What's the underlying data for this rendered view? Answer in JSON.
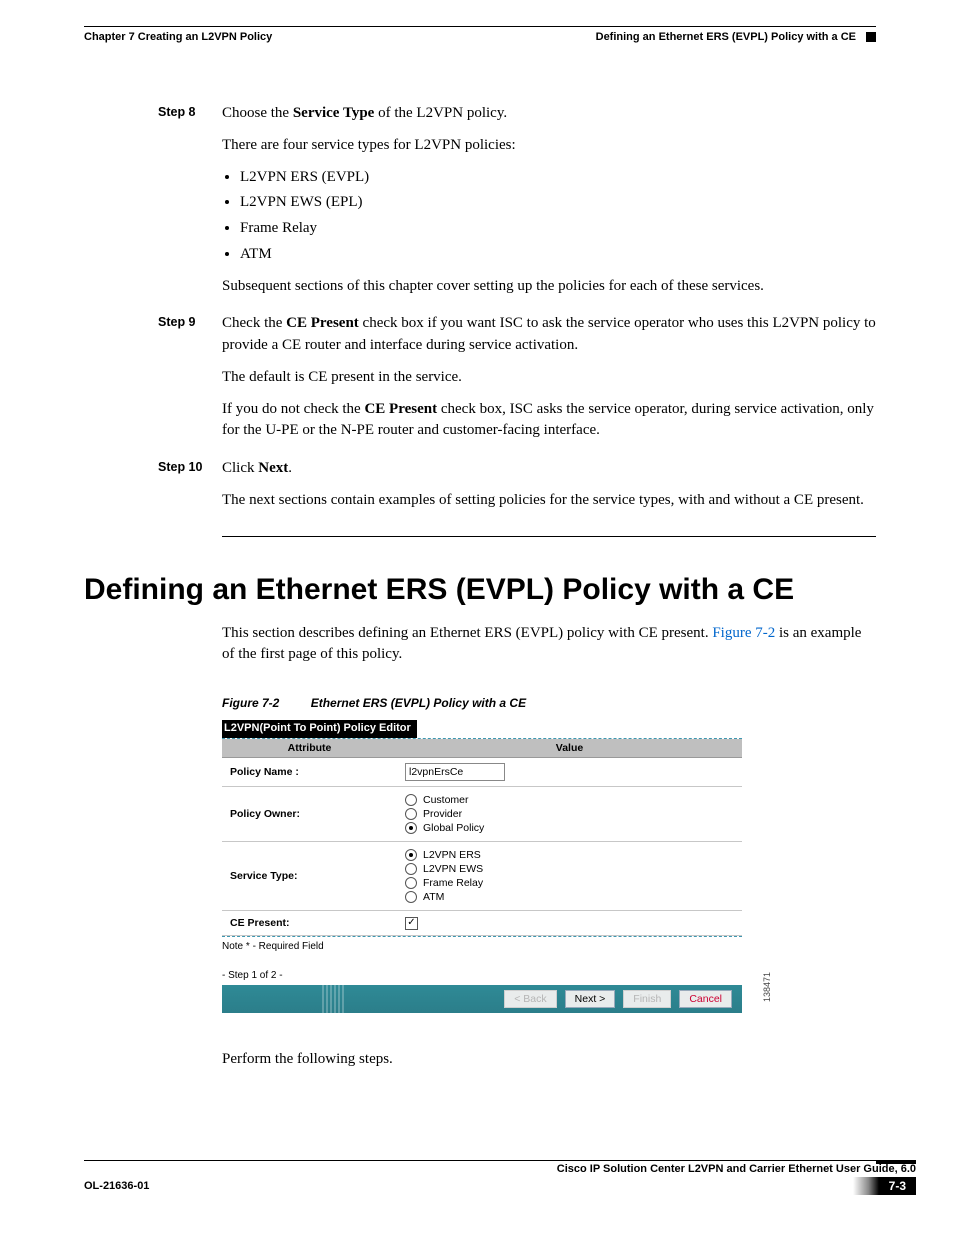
{
  "header": {
    "left": "Chapter 7      Creating an L2VPN Policy",
    "right": "Defining an Ethernet ERS (EVPL) Policy with a CE"
  },
  "steps": [
    {
      "label": "Step 8",
      "p1_pre": "Choose the ",
      "p1_bold": "Service Type",
      "p1_post": " of the L2VPN policy.",
      "p2": "There are four service types for L2VPN policies:",
      "bullets": [
        "L2VPN ERS (EVPL)",
        "L2VPN EWS (EPL)",
        "Frame Relay",
        "ATM"
      ],
      "p3": "Subsequent sections of this chapter cover setting up the policies for each of these services."
    },
    {
      "label": "Step 9",
      "p1_pre": "Check the ",
      "p1_bold": "CE Present",
      "p1_post": " check box if you want ISC to ask the service operator who uses this L2VPN policy to provide a CE router and interface during service activation.",
      "p2": "The default is CE present in the service.",
      "p3_pre": "If you do not check the ",
      "p3_bold": "CE Present",
      "p3_post": " check box, ISC asks the service operator, during service activation, only for the U-PE or the N-PE router and customer-facing interface."
    },
    {
      "label": "Step 10",
      "p1_pre": "Click ",
      "p1_bold": "Next",
      "p1_post": ".",
      "p2": "The next sections contain examples of setting policies for the service types, with and without a CE present."
    }
  ],
  "section": {
    "title": "Defining an Ethernet ERS (EVPL) Policy with a CE",
    "intro_pre": "This section describes defining an Ethernet ERS (EVPL) policy with CE present. ",
    "intro_link": "Figure 7-2",
    "intro_post": " is an example of the first page of this policy."
  },
  "figure": {
    "num": "Figure 7-2",
    "title": "Ethernet ERS (EVPL) Policy with a CE",
    "side_id": "138471"
  },
  "editor": {
    "title": "L2VPN(Point To Point) Policy Editor",
    "col_attr": "Attribute",
    "col_val": "Value",
    "rows": {
      "policy_name_label": "Policy Name :",
      "policy_name_value": "l2vpnErsCe",
      "policy_owner_label": "Policy Owner:",
      "owner_options": [
        {
          "label": "Customer",
          "selected": false
        },
        {
          "label": "Provider",
          "selected": false
        },
        {
          "label": "Global Policy",
          "selected": true
        }
      ],
      "service_type_label": "Service Type:",
      "service_options": [
        {
          "label": "L2VPN ERS",
          "selected": true
        },
        {
          "label": "L2VPN EWS",
          "selected": false
        },
        {
          "label": "Frame Relay",
          "selected": false
        },
        {
          "label": "ATM",
          "selected": false
        }
      ],
      "ce_present_label": "CE Present:",
      "ce_present_checked": true
    },
    "note": "Note * - Required Field",
    "step": "- Step 1 of 2 -",
    "buttons": {
      "back": "< Back",
      "next": "Next >",
      "finish": "Finish",
      "cancel": "Cancel"
    }
  },
  "after_fig": "Perform the following steps.",
  "footer": {
    "guide": "Cisco IP Solution Center L2VPN and Carrier Ethernet User Guide, 6.0",
    "docnum": "OL-21636-01",
    "pagenum": "7-3"
  }
}
